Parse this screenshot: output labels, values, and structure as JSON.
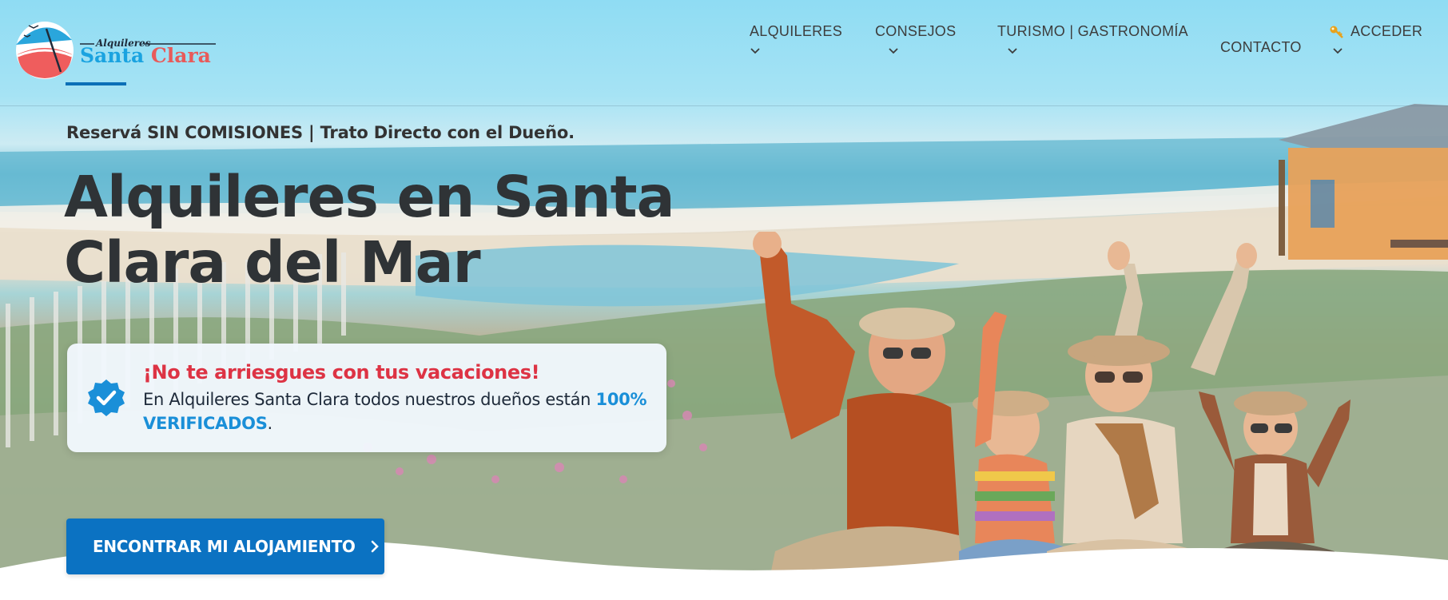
{
  "brand": {
    "logo_small": "Alquileres",
    "logo_word1": "Santa",
    "logo_word2": "Clara"
  },
  "nav": {
    "items": [
      {
        "label": "ALQUILERES",
        "has_dropdown": true
      },
      {
        "label": "CONSEJOS",
        "has_dropdown": true
      },
      {
        "label": "TURISMO | GASTRONOMÍA",
        "has_dropdown": true
      },
      {
        "label": "CONTACTO",
        "has_dropdown": false
      },
      {
        "label": "ACCEDER",
        "has_dropdown": true,
        "icon": "key-icon"
      }
    ]
  },
  "hero": {
    "tagline": "Reservá SIN COMISIONES | Trato Directo con el Dueño.",
    "title": "Alquileres en Santa Clara del Mar",
    "notice": {
      "icon": "verified-badge-icon",
      "title": "¡No te arriesgues con tus vacaciones!",
      "body_prefix": "En Alquileres Santa Clara todos nuestros dueños están ",
      "body_highlight": "100% VERIFICADOS",
      "body_suffix": "."
    },
    "cta_label": "ENCONTRAR MI ALOJAMIENTO"
  },
  "colors": {
    "accent_blue": "#0b72c2",
    "alert_red": "#dd3344",
    "highlight_blue": "#1a8fd8",
    "logo_blue": "#1aa3e0",
    "logo_red": "#e85a5a"
  }
}
